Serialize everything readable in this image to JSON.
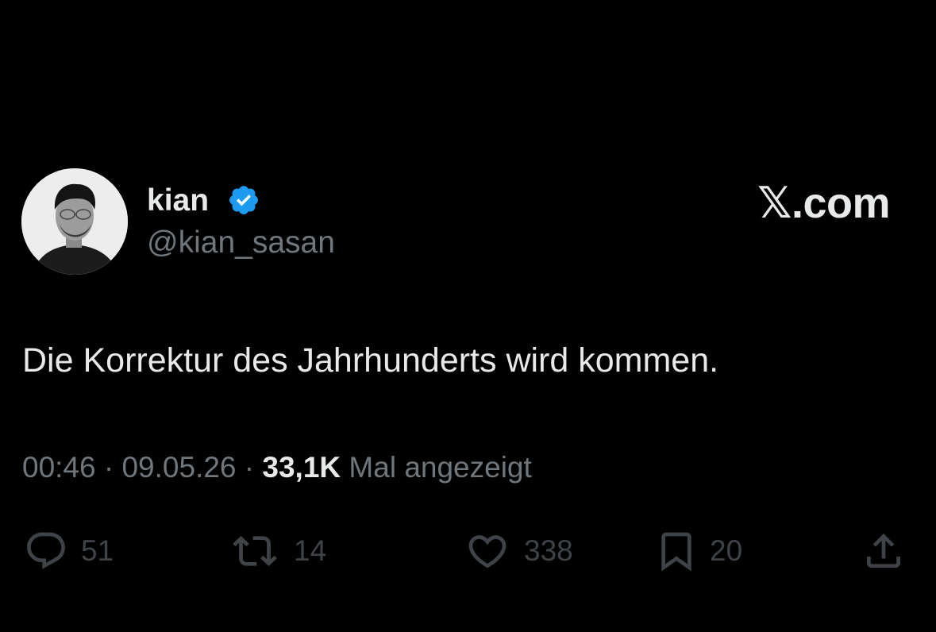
{
  "author": {
    "display_name": "kian",
    "handle": "@kian_sasan",
    "verified": true,
    "verified_color": "#1d9bf0",
    "avatar": "profile-photo"
  },
  "brand": "𝕏.com",
  "tweet": {
    "text": "Die Korrektur des Jahrhunderts wird kommen."
  },
  "meta": {
    "time": "00:46",
    "separator": " · ",
    "date": "09.05.26",
    "views_count": "33,1K",
    "views_label": " Mal angezeigt"
  },
  "actions": {
    "reply": {
      "icon": "reply-icon",
      "count": "51"
    },
    "repost": {
      "icon": "repost-icon",
      "count": "14"
    },
    "like": {
      "icon": "heart-icon",
      "count": "338"
    },
    "bookmark": {
      "icon": "bookmark-icon",
      "count": "20"
    },
    "share": {
      "icon": "share-icon"
    }
  },
  "colors": {
    "background": "#000000",
    "primary_text": "#e7e9ea",
    "secondary_text": "#71767b",
    "action_dim": "#3f4347"
  }
}
